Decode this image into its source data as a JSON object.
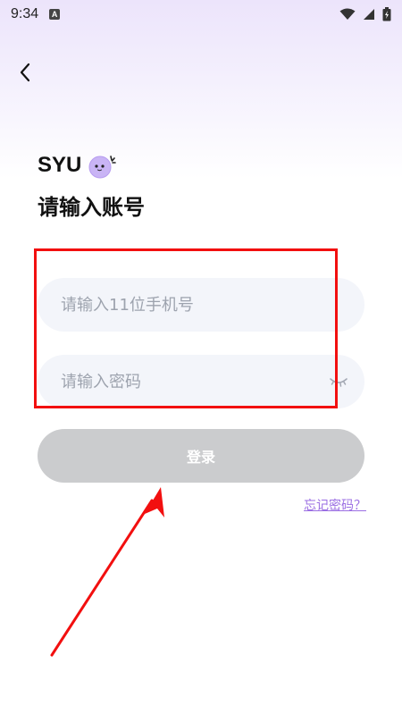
{
  "status_bar": {
    "time": "9:34",
    "app_badge": "A",
    "icons": [
      "wifi-icon",
      "cell-signal-icon",
      "battery-icon"
    ]
  },
  "header": {
    "back_icon": "chevron-left-icon"
  },
  "brand": {
    "name": "SYU",
    "mascot_icon": "mascot-icon"
  },
  "page": {
    "title": "请输入账号"
  },
  "form": {
    "phone_placeholder": "请输入11位手机号",
    "phone_value": "",
    "password_placeholder": "请输入密码",
    "password_value": "",
    "password_toggle_icon": "eye-closed-icon",
    "login_label": "登录",
    "forgot_label": "忘记密码？"
  },
  "colors": {
    "accent": "#9b6fe3",
    "login_disabled": "#cbccce",
    "field_bg": "#f3f5fa",
    "annotation": "#f20f0f"
  }
}
